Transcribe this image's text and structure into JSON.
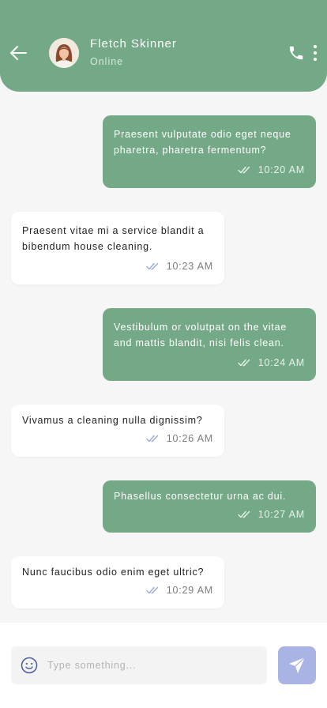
{
  "header": {
    "contact_name": "Fletch Skinner",
    "status": "Online"
  },
  "messages": [
    {
      "direction": "out",
      "line1": "Praesent vulputate odio eget neque",
      "line2": "pharetra, pharetra fermentum?",
      "time": "10:20 AM"
    },
    {
      "direction": "in",
      "line1": "Praesent vitae mi a service blandit a",
      "line2": "bibendum house cleaning.",
      "time": "10:23 AM"
    },
    {
      "direction": "out",
      "line1": "Vestibulum or volutpat on the vitae",
      "line2": "and mattis blandit, nisi felis clean.",
      "time": "10:24 AM"
    },
    {
      "direction": "in",
      "line1": "Vivamus a cleaning nulla dignissim?",
      "time": "10:26 AM"
    },
    {
      "direction": "out",
      "line1": "Phasellus consectetur urna ac dui.",
      "time": "10:27 AM"
    },
    {
      "direction": "in",
      "line1": "Nunc faucibus odio enim eget ultric?",
      "time": "10:29 AM"
    }
  ],
  "composer": {
    "placeholder": "Type something..."
  },
  "colors": {
    "accent": "#74a987",
    "send_button": "#a9b4e4",
    "read_check_out": "#e8f2ea",
    "read_check_in": "#9aaad8"
  }
}
